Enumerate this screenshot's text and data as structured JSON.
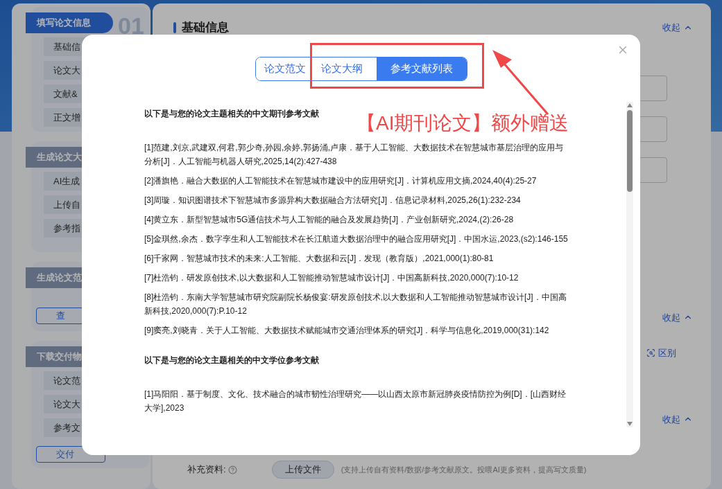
{
  "sidebar": {
    "sections": [
      {
        "title": "填写论文信息",
        "selected": true,
        "step": "01",
        "items": [
          "基础信",
          "论文大",
          "文献&",
          "正文增"
        ]
      },
      {
        "title": "生成论文大",
        "selected": false,
        "items": [
          "AI生成",
          "上传自",
          "参考指"
        ]
      },
      {
        "title": "生成论文范",
        "selected": false,
        "button": "查"
      },
      {
        "title": "下载交付物",
        "selected": false,
        "items": [
          "论文范",
          "论文大",
          "参考文"
        ],
        "button": "交付"
      }
    ]
  },
  "main": {
    "heading": "基础信息",
    "collapse_links": [
      "收起",
      "收起",
      "收起"
    ],
    "compare_link": "区别",
    "supplement": {
      "label": "补充资料:",
      "button": "上传文件",
      "hint": "(支持上传自有资料/数据/参考文献原文。投喂AI更多资料，提高写文质量)"
    }
  },
  "modal": {
    "tabs": [
      {
        "label": "论文范文",
        "selected": false
      },
      {
        "label": "论文大纲",
        "selected": false
      },
      {
        "label": "参考文献列表",
        "selected": true
      }
    ],
    "groups": [
      {
        "heading": "以下是与您的论文主题相关的中文期刊参考文献",
        "references": [
          "[1]范建,刘京,武建双,何君,郭少奇,孙园,余婷,郭扬涌,卢康．基于人工智能、大数据技术在智慧城市基层治理的应用与分析[J]．人工智能与机器人研究,2025,14(2):427-438",
          "[2]潘旗艳．融合大数据的人工智能技术在智慧城市建设中的应用研究[J]．计算机应用文摘,2024,40(4):25-27",
          "[3]周璇．知识图谱技术下智慧城市多源异构大数据融合方法研究[J]．信息记录材料,2025,26(1):232-234",
          "[4]黄立东．新型智慧城市5G通信技术与人工智能的融合及发展趋势[J]．产业创新研究,2024,(2):26-28",
          "[5]金琪然,余杰．数字孪生和人工智能技术在长江航道大数据治理中的融合应用研究[J]．中国水运,2023,(s2):146-155",
          "[6]千家网．智慧城市技术的未来:人工智能、大数据和云[J]．发现（教育版）,2021,000(1):80-81",
          "[7]杜浩钧．研发原创技术,以大数据和人工智能推动智慧城市设计[J]．中国高新科技,2020,000(7):10-12",
          "[8]杜浩钧．东南大学智慧城市研究院副院长杨俊宴:研发原创技术,以大数据和人工智能推动智慧城市设计[J]．中国高新科技,2020,000(7):P.10-12",
          "[9]窦亮,刘晓青．关于人工智能、大数据技术赋能城市交通治理体系的研究[J]．科学与信息化,2019,000(31):142"
        ]
      },
      {
        "heading": "以下是与您的论文主题相关的中文学位参考文献",
        "references": [
          "[1]马阳阳．基于制度、文化、技术融合的城市韧性治理研究——以山西太原市新冠肺炎疫情防控为例[D]．[山西财经大学],2023"
        ]
      }
    ]
  },
  "annotation": {
    "text": "【AI期刊论文】额外赠送"
  }
}
